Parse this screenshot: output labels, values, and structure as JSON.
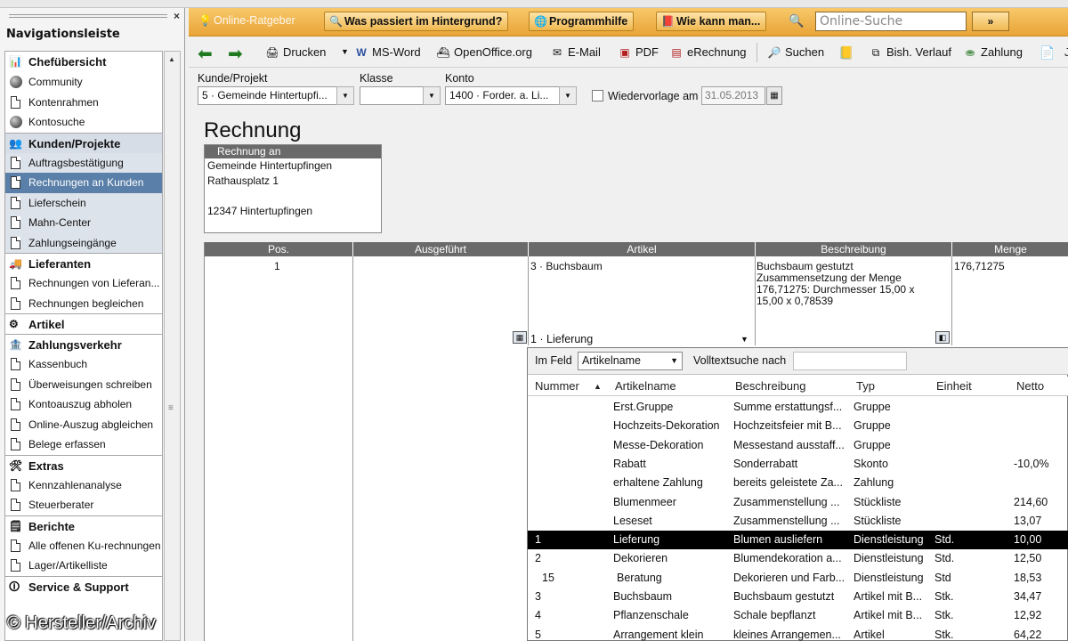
{
  "sidebar": {
    "title": "Navigationsleiste",
    "close": "×",
    "groups": [
      {
        "label": "Chefübersicht",
        "items": [
          "Community",
          "Kontenrahmen",
          "Kontosuche"
        ]
      },
      {
        "label": "Kunden/Projekte",
        "items": [
          "Auftragsbestätigung",
          "Rechnungen an Kunden",
          "Lieferschein",
          "Mahn-Center",
          "Zahlungseingänge"
        ]
      },
      {
        "label": "Lieferanten",
        "items": [
          "Rechnungen von Lieferan...",
          "Rechnungen begleichen"
        ]
      },
      {
        "label": "Artikel",
        "items": []
      },
      {
        "label": "Zahlungsverkehr",
        "items": [
          "Kassenbuch",
          "Überweisungen schreiben",
          "Kontoauszug abholen",
          "Online-Auszug abgleichen",
          "Belege erfassen"
        ]
      },
      {
        "label": "Extras",
        "items": [
          "Kennzahlenanalyse",
          "Steuerberater"
        ]
      },
      {
        "label": "Berichte",
        "items": [
          "Alle offenen Ku-rechnungen",
          "Lager/Artikelliste"
        ]
      },
      {
        "label": "Service & Support",
        "items": []
      }
    ]
  },
  "topbar": {
    "online_ratgeber": "Online-Ratgeber",
    "hintergrund": "Was passiert im Hintergrund?",
    "programmhilfe": "Programmhilfe",
    "wie_kann_man": "Wie kann man...",
    "search_placeholder": "Online-Suche",
    "search_go": "»"
  },
  "toolbar": {
    "drucken": "Drucken",
    "msword": "MS-Word",
    "openoffice": "OpenOffice.org",
    "email": "E-Mail",
    "pdf": "PDF",
    "erechnung": "eRechnung",
    "suchen": "Suchen",
    "verlauf": "Bish. Verlauf",
    "zahlung": "Zahlung",
    "jo": "Jo"
  },
  "form": {
    "kunde_label": "Kunde/Projekt",
    "kunde_value": "5 · Gemeinde Hintertupfi...",
    "klasse_label": "Klasse",
    "klasse_value": "",
    "konto_label": "Konto",
    "konto_value": "1400 · Forder. a. Li...",
    "wiedervorlage_label": "Wiedervorlage am",
    "wiedervorlage_date": "31.05.2013"
  },
  "invoice": {
    "title": "Rechnung",
    "address_head": "Rechnung an",
    "address_lines": [
      "Gemeinde Hintertupfingen",
      "Rathausplatz 1",
      "",
      "12347 Hintertupfingen"
    ]
  },
  "table": {
    "headers": [
      "Pos.",
      "Ausgeführt",
      "Artikel",
      "Beschreibung",
      "Menge"
    ],
    "row1": {
      "pos": "1",
      "artikel": "3 · Buchsbaum",
      "beschreibung": [
        "Buchsbaum gestutzt",
        "Zusammensetzung der Menge",
        "176,71275: Durchmesser 15,00 x",
        "15,00 x 0,78539"
      ],
      "menge": "176,71275"
    },
    "new_row_artikel": "1 · Lieferung"
  },
  "lookup": {
    "im_feld_label": "Im Feld",
    "im_feld_value": "Artikelname",
    "volltext_label": "Volltextsuche nach",
    "volltext_value": "",
    "columns": [
      "Nummer",
      "Artikelname",
      "Beschreibung",
      "Typ",
      "Einheit",
      "Netto"
    ],
    "rows": [
      {
        "nummer": "",
        "name": "Erst.Gruppe",
        "beschreibung": "Summe erstattungsf...",
        "typ": "Gruppe",
        "einheit": "",
        "netto": ""
      },
      {
        "nummer": "",
        "name": "Hochzeits-Dekoration",
        "beschreibung": "Hochzeitsfeier mit B...",
        "typ": "Gruppe",
        "einheit": "",
        "netto": ""
      },
      {
        "nummer": "",
        "name": "Messe-Dekoration",
        "beschreibung": "Messestand ausstaff...",
        "typ": "Gruppe",
        "einheit": "",
        "netto": ""
      },
      {
        "nummer": "",
        "name": "Rabatt",
        "beschreibung": "Sonderrabatt",
        "typ": "Skonto",
        "einheit": "",
        "netto": "-10,0%"
      },
      {
        "nummer": "",
        "name": "erhaltene Zahlung",
        "beschreibung": "bereits geleistete Za...",
        "typ": "Zahlung",
        "einheit": "",
        "netto": ""
      },
      {
        "nummer": "",
        "name": "Blumenmeer",
        "beschreibung": "Zusammenstellung ...",
        "typ": "Stückliste",
        "einheit": "",
        "netto": "214,60"
      },
      {
        "nummer": "",
        "name": "Leseset",
        "beschreibung": "Zusammenstellung ...",
        "typ": "Stückliste",
        "einheit": "",
        "netto": "13,07"
      },
      {
        "nummer": "1",
        "name": "Lieferung",
        "beschreibung": "Blumen ausliefern",
        "typ": "Dienstleistung",
        "einheit": "Std.",
        "netto": "10,00"
      },
      {
        "nummer": "2",
        "name": "Dekorieren",
        "beschreibung": "Blumendekoration a...",
        "typ": "Dienstleistung",
        "einheit": "Std.",
        "netto": "12,50"
      },
      {
        "nummer": "15",
        "name": "Beratung",
        "beschreibung": "Dekorieren und Farb...",
        "typ": "Dienstleistung",
        "einheit": "Std",
        "netto": "18,53"
      },
      {
        "nummer": "3",
        "name": "Buchsbaum",
        "beschreibung": "Buchsbaum gestutzt",
        "typ": "Artikel mit B...",
        "einheit": "Stk.",
        "netto": "34,47"
      },
      {
        "nummer": "4",
        "name": "Pflanzenschale",
        "beschreibung": "Schale bepflanzt",
        "typ": "Artikel mit B...",
        "einheit": "Stk.",
        "netto": "12,92"
      },
      {
        "nummer": "5",
        "name": "Arrangement klein",
        "beschreibung": "kleines Arrangemen...",
        "typ": "Artikel",
        "einheit": "Stk.",
        "netto": "64,22"
      }
    ]
  },
  "watermark": "© Hersteller/Archiv",
  "colors": {
    "orange_bar": "#e9a437",
    "header_gray": "#6a6a6a",
    "selected_row": "#000000",
    "sidebar_selected": "#5a7fa8"
  }
}
